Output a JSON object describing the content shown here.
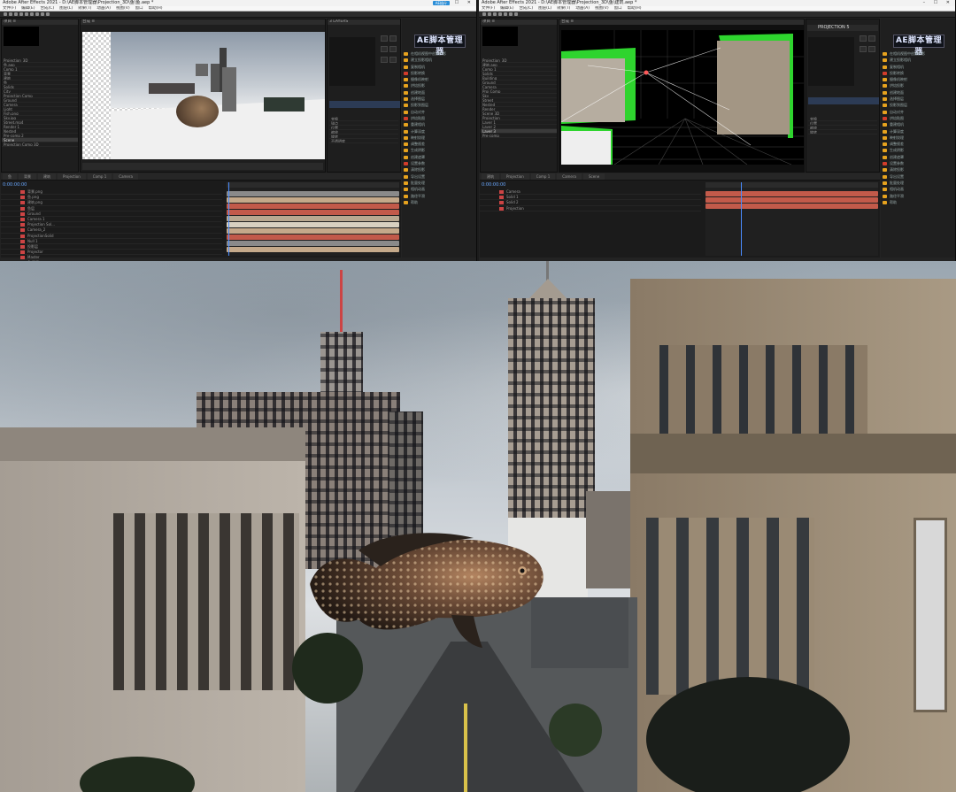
{
  "window_left": {
    "title": "Adobe After Effects 2021 - D:\\AE脚本管理器\\Projection_3D\\鱼\\鱼.aep *",
    "menu": [
      "文件(F)",
      "编辑(E)",
      "合成(C)",
      "图层(L)",
      "效果(T)",
      "动画(A)",
      "视图(V)",
      "窗口",
      "帮助(H)"
    ],
    "badge": "AE插件",
    "panels": {
      "project_header": "项目 ≡",
      "effects_header": "3 LAYERS",
      "script_logo": "AE脚本管理器",
      "timeline_tab": "0:00:00:00"
    },
    "project_items": [
      "Projection_3D",
      "鱼.aep",
      "Comp 1",
      "背景",
      "建筑",
      "鱼",
      "Solids",
      "City",
      "Projection Comp",
      "Ground",
      "Camera",
      "Light",
      "Fish.png",
      "Sky.jpg",
      "Street.mp4",
      "Render 1",
      "Nested",
      "Pre-comp 2",
      "Scene",
      "Projection Comp 3D"
    ],
    "layers": [
      "背景.png",
      "鱼.png",
      "建筑.png",
      "鱼层",
      "Ground",
      "Camera 1",
      "Projection Sol...",
      "Camera_2",
      "ProjectionSolid",
      "Null 1",
      "投影层",
      "Projector",
      "Master",
      "鱼 影子"
    ],
    "script_items": [
      "在相机视图中创建投影",
      "建立投影相机",
      "复制相机",
      "投影转换",
      "摄像机映射",
      "烘焙投影",
      "创建地面",
      "选择图层",
      "投影到图层",
      "自动对齐",
      "烘焙贴图",
      "重建相机",
      "计算深度",
      "映射纹理",
      "调整视差",
      "生成阴影",
      "创建遮罩",
      "设置参数",
      "清除投影",
      "导出设置",
      "批量处理",
      "相机动画",
      "路径平滑",
      "帮助"
    ],
    "timeline_tabs": [
      "鱼",
      "背景",
      "建筑",
      "Projection",
      "Comp 1",
      "Camera"
    ]
  },
  "window_right": {
    "title": "Adobe After Effects 2021 - D:\\AE脚本管理器\\Projection_3D\\鱼\\建筑.aep *",
    "menu": [
      "文件(F)",
      "编辑(E)",
      "合成(C)",
      "图层(L)",
      "效果(T)",
      "动画(A)",
      "视图(V)",
      "窗口",
      "帮助(H)"
    ],
    "panels": {
      "project_header": "项目 ≡",
      "projection_label": "PROJECTION 5",
      "script_logo": "AE脚本管理器",
      "timeline_tab": "0:00:00:00"
    },
    "project_items": [
      "Projection_3D",
      "建筑.aep",
      "Comp 1",
      "Solids",
      "Building",
      "Ground",
      "Camera",
      "Proj Comp",
      "Sky",
      "Street",
      "Nested",
      "Render",
      "Scene 3D",
      "Projection",
      "Layer 1",
      "Layer 2",
      "Layer 3",
      "Pre-comp"
    ],
    "layers": [
      "Camera",
      "Solid 1",
      "Solid 2",
      "Projection"
    ],
    "script_items": [
      "在相机视图中创建投影",
      "建立投影相机",
      "复制相机",
      "投影转换",
      "摄像机映射",
      "烘焙投影",
      "创建地面",
      "选择图层",
      "投影到图层",
      "自动对齐",
      "烘焙贴图",
      "重建相机",
      "计算深度",
      "映射纹理",
      "调整视差",
      "生成阴影",
      "创建遮罩",
      "设置参数",
      "清除投影",
      "导出设置",
      "批量处理",
      "相机动画",
      "路径平滑",
      "帮助"
    ],
    "timeline_tabs": [
      "建筑",
      "Projection",
      "Comp 1",
      "Camera",
      "Scene"
    ]
  },
  "colors": {
    "accent_orange": "#e6a21e",
    "track_red": "#c25a4a",
    "track_tan": "#c4a98a",
    "track_gray": "#8a8a8a",
    "green_screen": "#2ed42e",
    "titlebar": "#f2f2f2"
  },
  "photo": {
    "scene": "city street with giant fish",
    "icons": [
      "fish",
      "buildings",
      "street"
    ]
  }
}
